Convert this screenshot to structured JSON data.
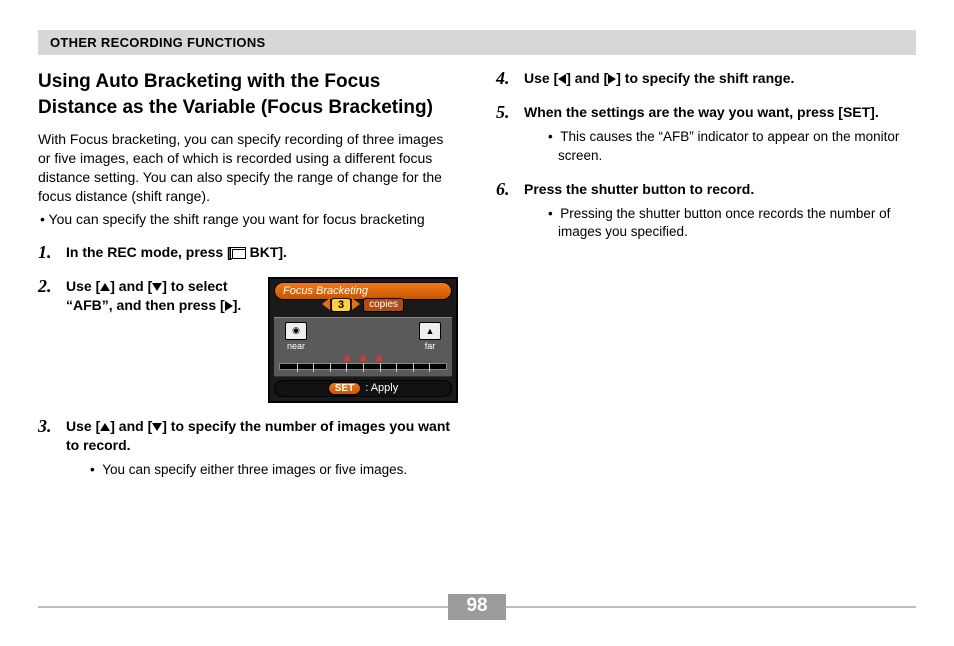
{
  "header": "OTHER RECORDING FUNCTIONS",
  "title": "Using Auto Bracketing with the Focus Distance as the Variable (Focus Bracketing)",
  "intro": "With Focus bracketing, you can specify recording of three images or five images, each of which is recorded using a different focus distance setting. You can also specify the range of change for the focus distance (shift range).",
  "intro_bullet": "You can specify the shift range you want for focus bracketing",
  "steps": {
    "s1": {
      "num": "1.",
      "pre": "In the REC mode, press [",
      "post": " BKT]."
    },
    "s2": {
      "num": "2.",
      "text_parts": [
        "Use [",
        "] and [",
        "] to select “AFB”, and then press [",
        "]."
      ]
    },
    "s3": {
      "num": "3.",
      "text_parts": [
        "Use [",
        "] and [",
        "] to specify the number of images you want to record."
      ],
      "sub": "You can specify either three images or five images."
    },
    "s4": {
      "num": "4.",
      "text_parts": [
        "Use [",
        "] and [",
        "] to specify the shift range."
      ]
    },
    "s5": {
      "num": "5.",
      "text": "When the settings are the way you want, press [SET].",
      "sub": "This causes the “AFB” indicator to appear on the monitor screen."
    },
    "s6": {
      "num": "6.",
      "text": "Press the shutter button to record.",
      "sub": "Pressing the shutter button once records the number of images you specified."
    }
  },
  "figure": {
    "title": "Focus Bracketing",
    "count": "3",
    "copies": "copies",
    "near": "near",
    "far": "far",
    "set": "SET",
    "apply": ": Apply"
  },
  "page_number": "98"
}
